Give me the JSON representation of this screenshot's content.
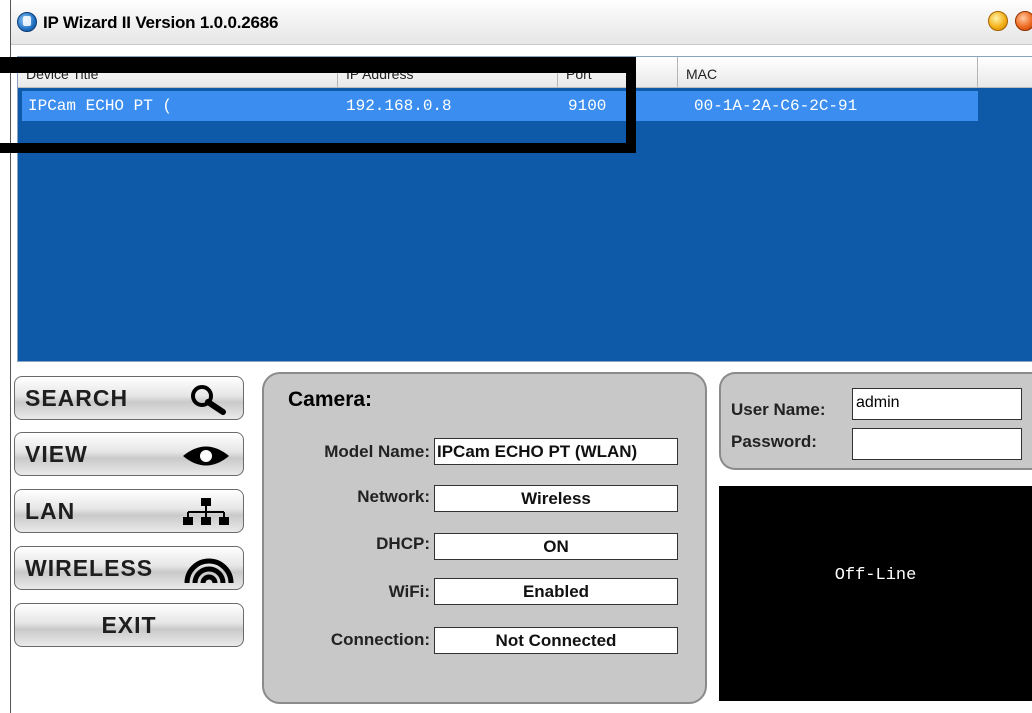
{
  "window": {
    "title": "IP Wizard II  Version 1.0.0.2686"
  },
  "device_list": {
    "columns": [
      "Device Title",
      "IP Address",
      "Port",
      "MAC",
      ""
    ],
    "rows": [
      {
        "title": "IPCam ECHO PT (",
        "ip": "192.168.0.8",
        "port": "9100",
        "mac": "00-1A-2A-C6-2C-91",
        "selected": true
      }
    ],
    "background_color": "#0e5aa8",
    "selection_color": "#3b8ef0"
  },
  "nav_buttons": {
    "search": {
      "label": "SEARCH",
      "icon": "magnifier-icon"
    },
    "view": {
      "label": "VIEW",
      "icon": "eye-icon"
    },
    "lan": {
      "label": "LAN",
      "icon": "network-icon"
    },
    "wireless": {
      "label": "WIRELESS",
      "icon": "wireless-signal-icon"
    },
    "exit": {
      "label": "EXIT"
    }
  },
  "camera": {
    "heading": "Camera:",
    "model_name_label": "Model Name:",
    "model_name": "IPCam ECHO PT (WLAN)",
    "network_label": "Network:",
    "network": "Wireless",
    "dhcp_label": "DHCP:",
    "dhcp": "ON",
    "wifi_label": "WiFi:",
    "wifi": "Enabled",
    "connection_label": "Connection:",
    "connection": "Not Connected"
  },
  "login": {
    "username_label": "User Name:",
    "username": "admin",
    "password_label": "Password:",
    "password": ""
  },
  "preview": {
    "status": "Off-Line"
  }
}
